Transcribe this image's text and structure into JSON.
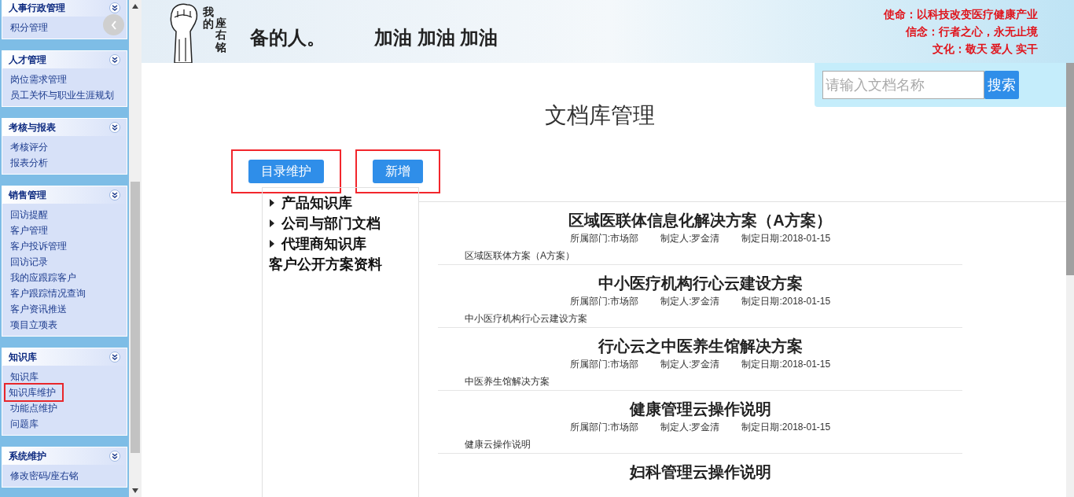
{
  "sidebar": {
    "groups": [
      {
        "title": "人事行政管理",
        "items": [
          {
            "label": "积分管理",
            "selected": false
          }
        ]
      },
      {
        "title": "人才管理",
        "items": [
          {
            "label": "岗位需求管理",
            "selected": false
          },
          {
            "label": "员工关怀与职业生涯规划",
            "selected": false
          }
        ]
      },
      {
        "title": "考核与报表",
        "items": [
          {
            "label": "考核评分",
            "selected": false
          },
          {
            "label": "报表分析",
            "selected": false
          }
        ]
      },
      {
        "title": "销售管理",
        "items": [
          {
            "label": "回访提醒",
            "selected": false
          },
          {
            "label": "客户管理",
            "selected": false
          },
          {
            "label": "客户投诉管理",
            "selected": false
          },
          {
            "label": "回访记录",
            "selected": false
          },
          {
            "label": "我的应跟踪客户",
            "selected": false
          },
          {
            "label": "客户跟踪情况查询",
            "selected": false
          },
          {
            "label": "客户资讯推送",
            "selected": false
          },
          {
            "label": "项目立项表",
            "selected": false
          }
        ]
      },
      {
        "title": "知识库",
        "items": [
          {
            "label": "知识库",
            "selected": false
          },
          {
            "label": "知识库维护",
            "selected": true
          },
          {
            "label": "功能点维护",
            "selected": false
          },
          {
            "label": "问题库",
            "selected": false
          }
        ]
      },
      {
        "title": "系统维护",
        "items": [
          {
            "label": "修改密码/座右铭",
            "selected": false
          }
        ]
      }
    ]
  },
  "banner": {
    "badge_top": "我的",
    "badge_bottom": "座右铭",
    "motto": "备的人。",
    "cheer": "加油 加油 加油",
    "values": [
      "使命：以科技改变医疗健康产业",
      "信念：行者之心，永无止境",
      "文化：敬天 爱人 实干"
    ]
  },
  "search": {
    "placeholder": "请输入文档名称",
    "button": "搜索"
  },
  "title": "文档库管理",
  "actions": [
    {
      "label": "目录维护",
      "highlighted": true
    },
    {
      "label": "新增",
      "highlighted": true
    }
  ],
  "tree": [
    {
      "label": "产品知识库",
      "kind": "folder"
    },
    {
      "label": "公司与部门文档",
      "kind": "folder"
    },
    {
      "label": "代理商知识库",
      "kind": "folder"
    },
    {
      "label": "客户公开方案资料",
      "kind": "leaf"
    }
  ],
  "documents": [
    {
      "title": "区域医联体信息化解决方案（A方案）",
      "department": "所属部门:市场部",
      "author": "制定人:罗金清",
      "date": "制定日期:2018-01-15",
      "description": "区域医联体方案（A方案）"
    },
    {
      "title": "中小医疗机构行心云建设方案",
      "department": "所属部门:市场部",
      "author": "制定人:罗金清",
      "date": "制定日期:2018-01-15",
      "description": "中小医疗机构行心云建设方案"
    },
    {
      "title": "行心云之中医养生馆解决方案",
      "department": "所属部门:市场部",
      "author": "制定人:罗金清",
      "date": "制定日期:2018-01-15",
      "description": "中医养生馆解决方案"
    },
    {
      "title": "健康管理云操作说明",
      "department": "所属部门:市场部",
      "author": "制定人:罗金清",
      "date": "制定日期:2018-01-15",
      "description": "健康云操作说明"
    },
    {
      "title": "妇科管理云操作说明"
    }
  ]
}
